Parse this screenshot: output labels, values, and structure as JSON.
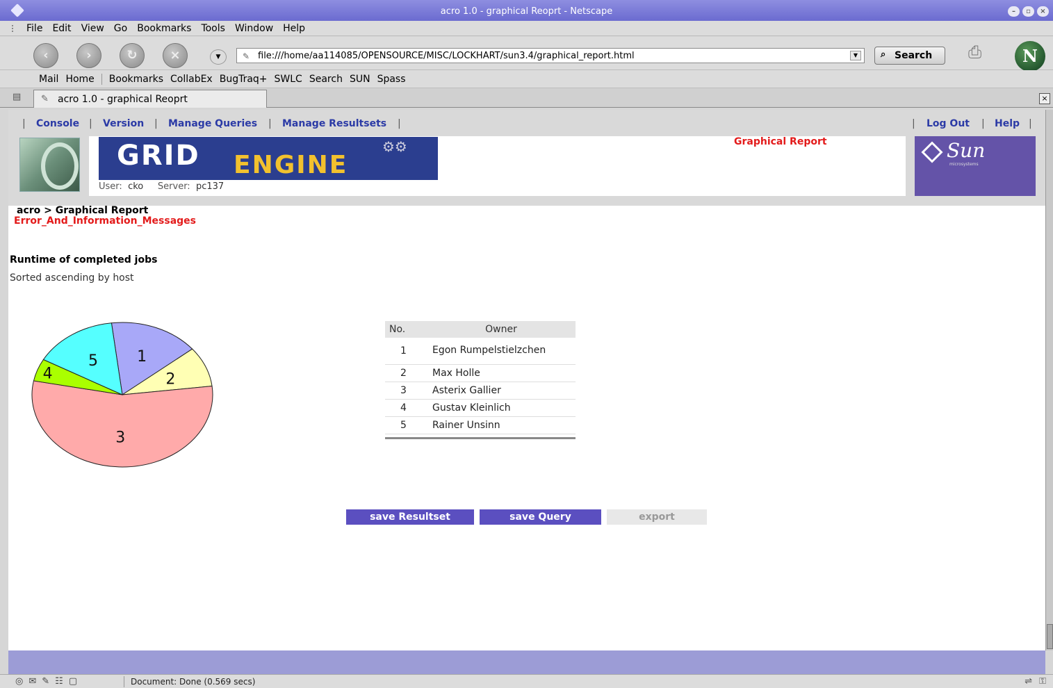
{
  "window": {
    "title": "acro 1.0 - graphical Reoprt - Netscape"
  },
  "menubar": {
    "items": [
      "File",
      "Edit",
      "View",
      "Go",
      "Bookmarks",
      "Tools",
      "Window",
      "Help"
    ]
  },
  "navbar": {
    "url": "file:///home/aa114085/OPENSOURCE/MISC/LOCKHART/sun3.4/graphical_report.html",
    "search_label": "Search"
  },
  "personal_toolbar": {
    "items": [
      "Mail",
      "Home",
      "Bookmarks",
      "CollabEx",
      "BugTraq+",
      "SWLC",
      "Search",
      "SUN",
      "Spass"
    ]
  },
  "tab": {
    "label": "acro 1.0 - graphical Reoprt"
  },
  "page": {
    "topnav": {
      "console": "Console",
      "version": "Version",
      "manage_queries": "Manage Queries",
      "manage_resultsets": "Manage Resultsets",
      "logout": "Log Out",
      "help": "Help"
    },
    "logo": {
      "grid": "GRID",
      "engine": "ENGINE"
    },
    "sun_logo": {
      "text": "Sun",
      "sub": "microsystems"
    },
    "user_label": "User:",
    "user": "cko",
    "server_label": "Server:",
    "server": "pc137",
    "page_title": "Graphical Report",
    "breadcrumb": "acro > Graphical Report",
    "error_link": "Error_And_Information_Messages",
    "report_title": "Runtime of completed jobs",
    "report_subtitle": "Sorted ascending by host",
    "table": {
      "headers": [
        "No.",
        "Owner"
      ],
      "rows": [
        {
          "no": "1",
          "owner": "Egon Rumpelstielzchen"
        },
        {
          "no": "2",
          "owner": "Max Holle"
        },
        {
          "no": "3",
          "owner": "Asterix Gallier"
        },
        {
          "no": "4",
          "owner": "Gustav Kleinlich"
        },
        {
          "no": "5",
          "owner": "Rainer Unsinn"
        }
      ]
    },
    "buttons": {
      "save_resultset": "save Resultset",
      "save_query": "save Query",
      "export": "export"
    }
  },
  "chart_data": {
    "type": "pie",
    "categories": [
      "1",
      "2",
      "3",
      "4",
      "5"
    ],
    "values": [
      16,
      9,
      55,
      5,
      15
    ],
    "colors": [
      "#a8a8f8",
      "#ffffb4",
      "#ffaaaa",
      "#aaff00",
      "#55ffff"
    ]
  },
  "statusbar": {
    "message": "Document: Done (0.569 secs)"
  }
}
